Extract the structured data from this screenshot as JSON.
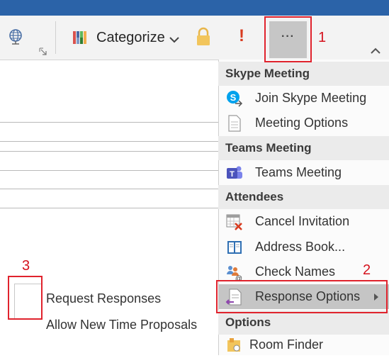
{
  "ribbon": {
    "categorize_label": "Categorize",
    "importance_glyph": "!",
    "more_glyph": "···",
    "icons": [
      "globe-icon",
      "dialog-launcher-icon",
      "categorize-icon",
      "chevron-down-icon",
      "lock-icon",
      "importance-high-icon",
      "more-options-icon",
      "collapse-ribbon-icon"
    ]
  },
  "annotations": {
    "n1": "1",
    "n2": "2",
    "n3": "3",
    "color": "#e0232d"
  },
  "menu": {
    "sections": {
      "skype": "Skype Meeting",
      "teams": "Teams Meeting",
      "attendees": "Attendees",
      "options": "Options"
    },
    "items": {
      "join_skype": "Join Skype Meeting",
      "meeting_options": "Meeting Options",
      "teams_meeting": "Teams Meeting",
      "cancel_invitation": "Cancel Invitation",
      "address_book": "Address Book...",
      "check_names": "Check Names",
      "response_options": "Response Options",
      "room_finder": "Room Finder"
    }
  },
  "response_options": {
    "request_responses": "Request Responses",
    "allow_new_time": "Allow New Time Proposals"
  },
  "colors": {
    "accent_blue": "#2b63a8",
    "selected_bg": "#c5c5c5",
    "section_bg": "#ebebeb"
  }
}
